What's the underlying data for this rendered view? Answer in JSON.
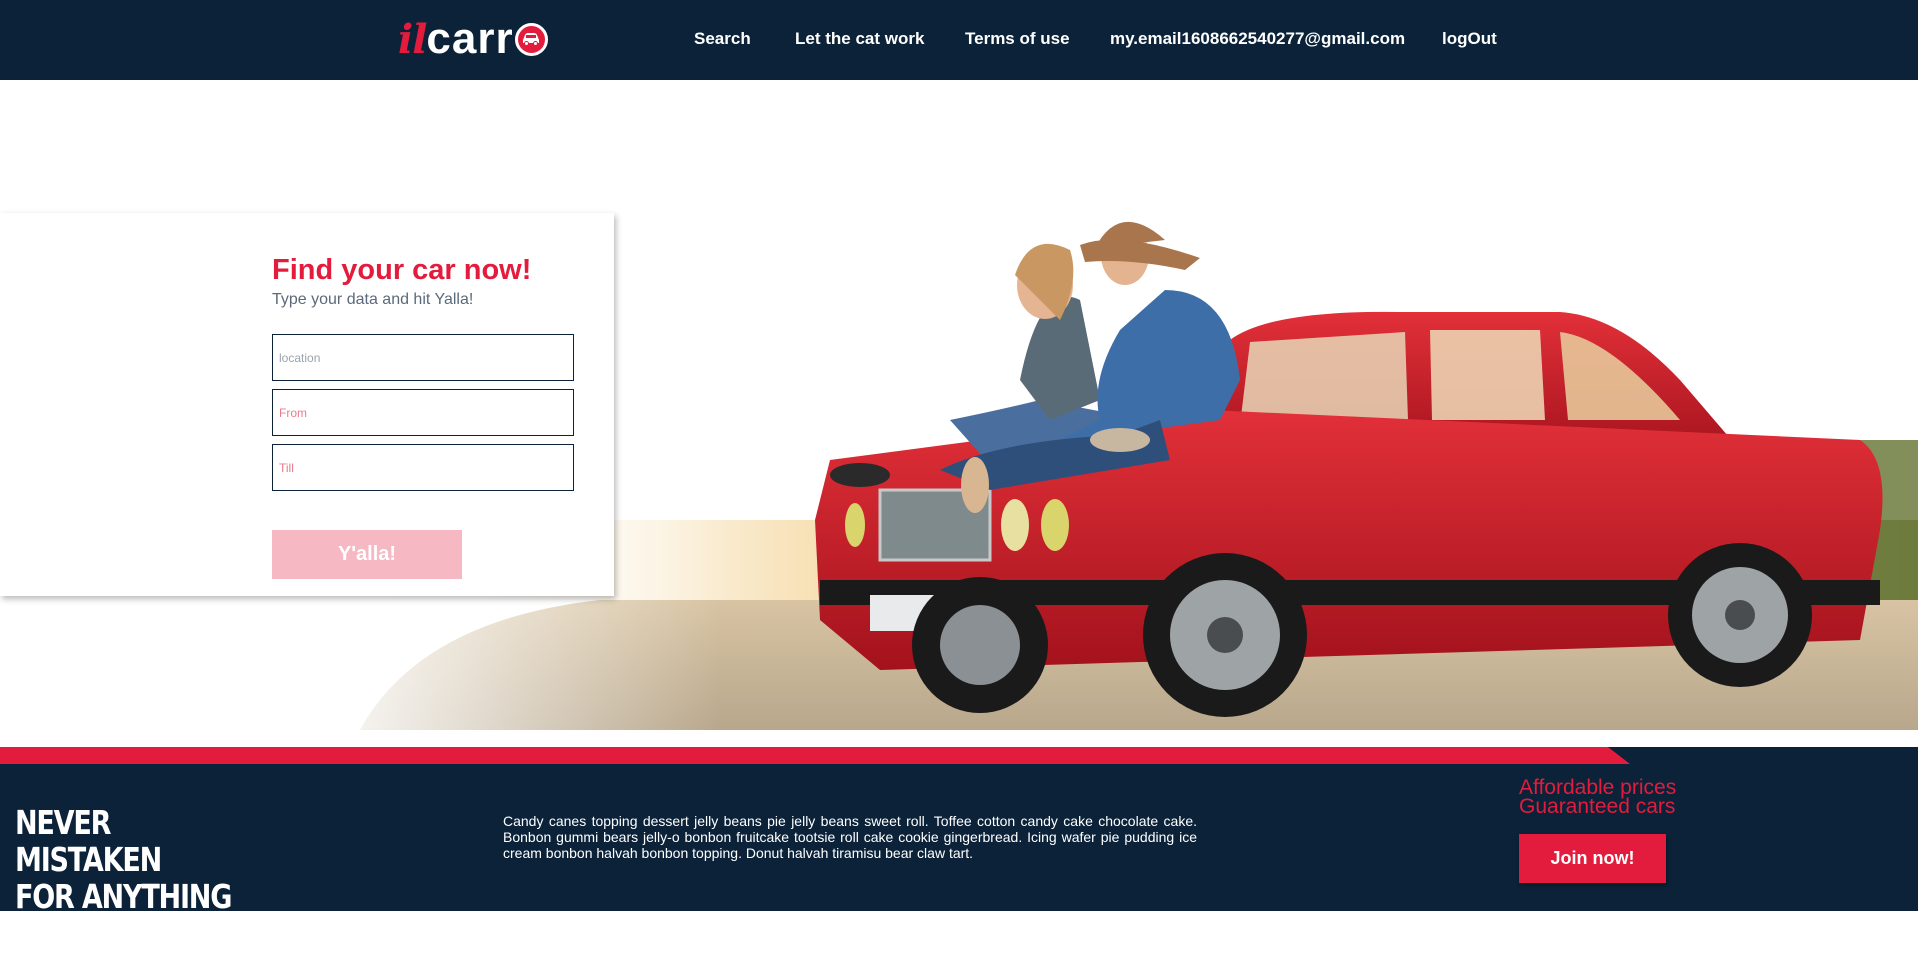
{
  "header": {
    "logo": {
      "part1": "il",
      "part2": "carr"
    },
    "nav": [
      {
        "label": "Search"
      },
      {
        "label": "Let the cat work"
      },
      {
        "label": "Terms of use"
      },
      {
        "label": "my.email1608662540277@gmail.com"
      },
      {
        "label": "logOut"
      }
    ]
  },
  "search": {
    "title": "Find your car now!",
    "subtitle": "Type your data and hit Yalla!",
    "location_placeholder": "location",
    "from_placeholder": "From",
    "till_placeholder": "Till",
    "button_label": "Y'alla!"
  },
  "footer": {
    "slogan_line1": "NEVER MISTAKEN",
    "slogan_line2": "FOR ANYTHING ELSE",
    "text": "Candy canes topping dessert jelly beans pie jelly beans sweet roll. Toffee cotton candy cake chocolate cake. Bonbon gummi bears jelly-o bonbon fruitcake tootsie roll cake cookie gingerbread. Icing wafer pie pudding ice cream bonbon halvah bonbon topping. Donut halvah tiramisu bear claw tart.",
    "promo_line1": "Affordable prices",
    "promo_line2": "Guaranteed cars",
    "join_label": "Join now!"
  },
  "colors": {
    "navy": "#0b2239",
    "brand_red": "#e31c3d",
    "button_disabled": "#f6b8c2"
  },
  "icons": {
    "logo_badge": "car-icon"
  }
}
